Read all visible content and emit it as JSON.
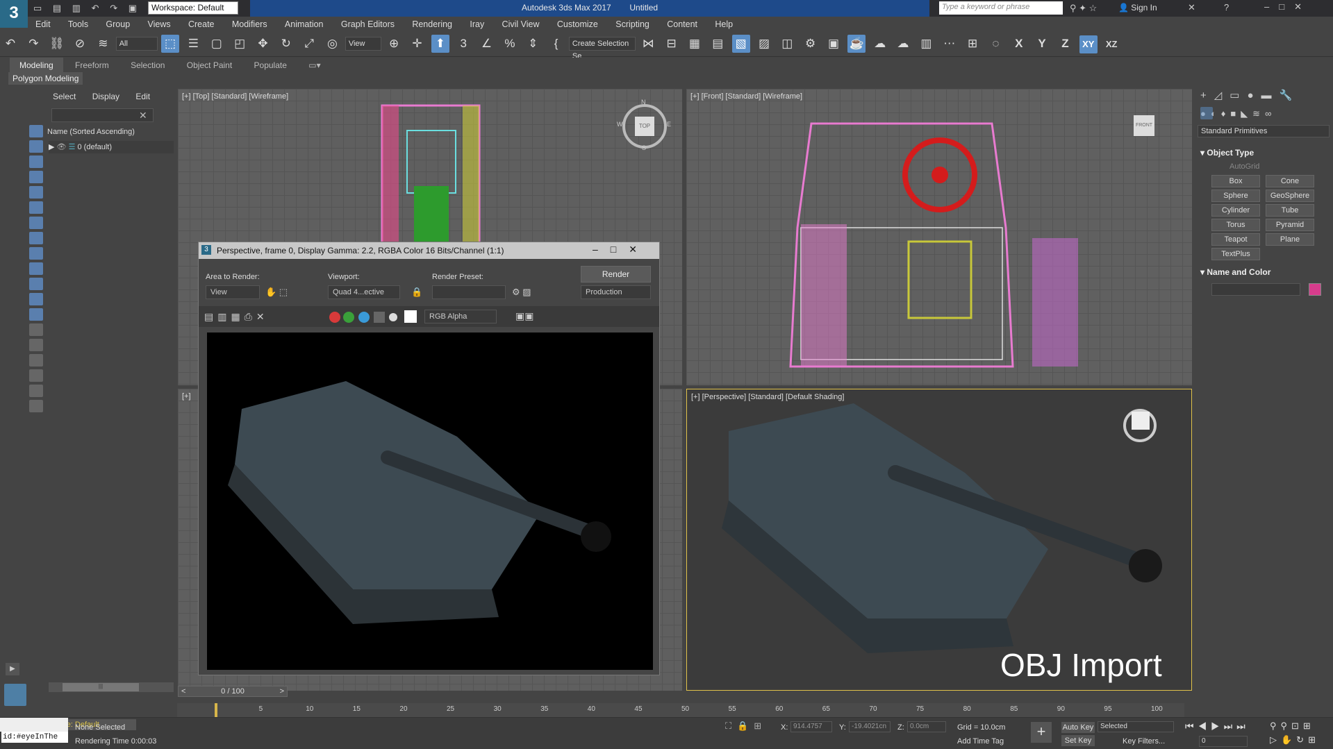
{
  "app": {
    "window_title": "Autodesk 3ds Max 2017",
    "document": "Untitled",
    "workspace": "Workspace: Default",
    "search_placeholder": "Type a keyword or phrase",
    "sign_in": "Sign In"
  },
  "menu": [
    "Edit",
    "Tools",
    "Group",
    "Views",
    "Create",
    "Modifiers",
    "Animation",
    "Graph Editors",
    "Rendering",
    "Iray",
    "Civil View",
    "Customize",
    "Scripting",
    "Content",
    "Help"
  ],
  "toolbar": {
    "selection_filter": "All",
    "ref_coord": "View",
    "named_selection": "Create Selection Se",
    "axes": [
      "X",
      "Y",
      "Z",
      "XY",
      "XZ"
    ]
  },
  "ribbon": {
    "tabs": [
      "Modeling",
      "Freeform",
      "Selection",
      "Object Paint",
      "Populate"
    ],
    "active": "Modeling",
    "panel": "Polygon Modeling"
  },
  "scene_explorer": {
    "tabs": [
      "Select",
      "Display",
      "Edit"
    ],
    "column_header": "Name (Sorted Ascending)",
    "items": [
      "0 (default)"
    ],
    "scroll_label": "|||"
  },
  "viewports": {
    "top": "[+] [Top] [Standard] [Wireframe]",
    "front": "[+] [Front] [Standard] [Wireframe]",
    "left": "[+]",
    "perspective": "[+] [Perspective] [Standard] [Default Shading]",
    "perspective_overlay": "OBJ Import",
    "viewcube_top": "TOP",
    "viewcube_front": "FRONT",
    "compass_n": "N",
    "compass_s": "S",
    "compass_e": "E",
    "compass_w": "W"
  },
  "render_window": {
    "title": "Perspective, frame 0, Display Gamma: 2.2, RGBA Color 16 Bits/Channel (1:1)",
    "area_to_render_label": "Area to Render:",
    "area_to_render": "View",
    "viewport_label": "Viewport:",
    "viewport": "Quad 4...ective",
    "render_preset_label": "Render Preset:",
    "render_preset": "",
    "render_button": "Render",
    "production": "Production",
    "channel": "RGB Alpha"
  },
  "command_panel": {
    "category": "Standard Primitives",
    "object_type_header": "Object Type",
    "autogrid": "AutoGrid",
    "primitives": [
      "Box",
      "Cone",
      "Sphere",
      "GeoSphere",
      "Cylinder",
      "Tube",
      "Torus",
      "Pyramid",
      "Teapot",
      "Plane",
      "TextPlus"
    ],
    "name_color_header": "Name and Color",
    "swatch_color": "#d63c8c"
  },
  "timeline": {
    "frame_counter": "0 / 100",
    "ticks": [
      "5",
      "10",
      "15",
      "20",
      "25",
      "30",
      "35",
      "40",
      "45",
      "50",
      "55",
      "60",
      "65",
      "70",
      "75",
      "80",
      "85",
      "90",
      "95",
      "100"
    ]
  },
  "status": {
    "maxscript_input": "id:#eyeInThe",
    "selection": "None Selected",
    "rendering_time": "Rendering Time  0:00:03",
    "x_label": "X:",
    "x_value": "914.4757",
    "y_label": "Y:",
    "y_value": "-19.4021cn",
    "z_label": "Z:",
    "z_value": "0.0cm",
    "grid": "Grid = 10.0cm",
    "add_time_tag": "Add Time Tag",
    "auto_key": "Auto Key",
    "set_key": "Set Key",
    "key_mode": "Selected",
    "key_filters": "Key Filters...",
    "frame": "0",
    "workspace_bottom": "Workspace: Default"
  }
}
